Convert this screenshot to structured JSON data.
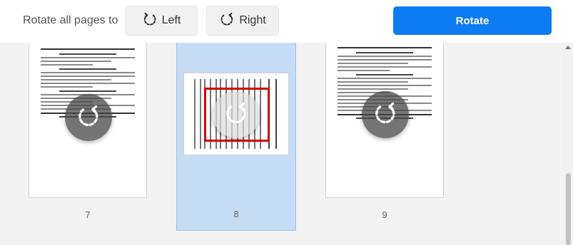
{
  "toolbar": {
    "label": "Rotate all pages to",
    "left_label": "Left",
    "right_label": "Right",
    "rotate_label": "Rotate"
  },
  "pages": [
    {
      "number": "7",
      "selected": false
    },
    {
      "number": "8",
      "selected": true
    },
    {
      "number": "9",
      "selected": false
    }
  ],
  "colors": {
    "accent": "#0d7cf2",
    "selected_tile": "#c6dcf4",
    "highlight_border": "#d40000"
  }
}
